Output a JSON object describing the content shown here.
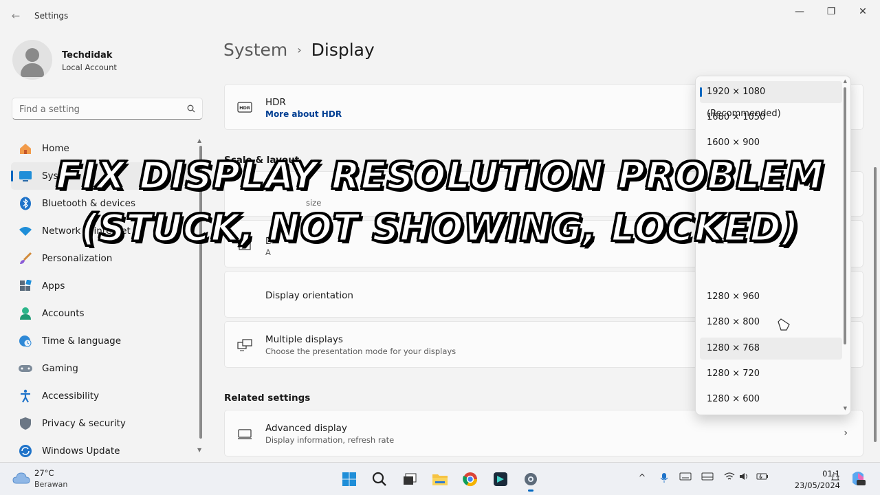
{
  "window": {
    "app_title": "Settings",
    "back_icon": "back-arrow-icon",
    "controls": {
      "minimize": "—",
      "maximize": "❐",
      "close": "✕"
    }
  },
  "profile": {
    "name": "Techdidak",
    "account_type": "Local Account"
  },
  "search": {
    "placeholder": "Find a setting"
  },
  "nav": {
    "items": [
      {
        "label": "Home",
        "icon": "home-icon",
        "active": false
      },
      {
        "label": "System",
        "icon": "system-icon",
        "active": true
      },
      {
        "label": "Bluetooth & devices",
        "icon": "bluetooth-icon",
        "active": false
      },
      {
        "label": "Network & internet",
        "icon": "wifi-icon",
        "active": false
      },
      {
        "label": "Personalization",
        "icon": "brush-icon",
        "active": false
      },
      {
        "label": "Apps",
        "icon": "apps-icon",
        "active": false
      },
      {
        "label": "Accounts",
        "icon": "accounts-icon",
        "active": false
      },
      {
        "label": "Time & language",
        "icon": "globe-clock-icon",
        "active": false
      },
      {
        "label": "Gaming",
        "icon": "gamepad-icon",
        "active": false
      },
      {
        "label": "Accessibility",
        "icon": "accessibility-icon",
        "active": false
      },
      {
        "label": "Privacy & security",
        "icon": "shield-icon",
        "active": false
      },
      {
        "label": "Windows Update",
        "icon": "update-icon",
        "active": false
      }
    ]
  },
  "breadcrumb": {
    "parent": "System",
    "separator": "›",
    "current": "Display"
  },
  "hdr_card": {
    "title": "HDR",
    "link": "More about HDR",
    "icon_text": "HDR"
  },
  "scale_section": {
    "title": "Scale & layout"
  },
  "scale_card": {
    "subtitle_fragment": "size"
  },
  "display_res_card": {
    "title_fragment": "D",
    "subtitle_fragment": "A"
  },
  "orientation_card": {
    "title": "Display orientation"
  },
  "multiple_displays_card": {
    "title": "Multiple displays",
    "subtitle": "Choose the presentation mode for your displays"
  },
  "related_section": {
    "title": "Related settings"
  },
  "advanced_display_card": {
    "title": "Advanced display",
    "subtitle": "Display information, refresh rate"
  },
  "resolution_dropdown": {
    "options": [
      "1920 × 1080 (Recommended)",
      "1680 × 1050",
      "1600 × 900",
      "1280 × 960",
      "1280 × 800",
      "1280 × 768",
      "1280 × 720",
      "1280 × 600"
    ],
    "selected": "1920 × 1080 (Recommended)",
    "hovered": "1280 × 768"
  },
  "overlay": {
    "line1": "FIX DISPLAY RESOLUTION PROBLEM",
    "line2": "(STUCK, NOT SHOWING, LOCKED)"
  },
  "taskbar": {
    "weather_temp": "27°C",
    "weather_desc": "Berawan",
    "apps": [
      "start-icon",
      "search-icon",
      "task-view-icon",
      "file-explorer-icon",
      "chrome-icon",
      "capcut-icon",
      "settings-icon"
    ],
    "clock_time": "01:1",
    "clock_date": "23/05/2024",
    "accent": "#0067c0"
  }
}
